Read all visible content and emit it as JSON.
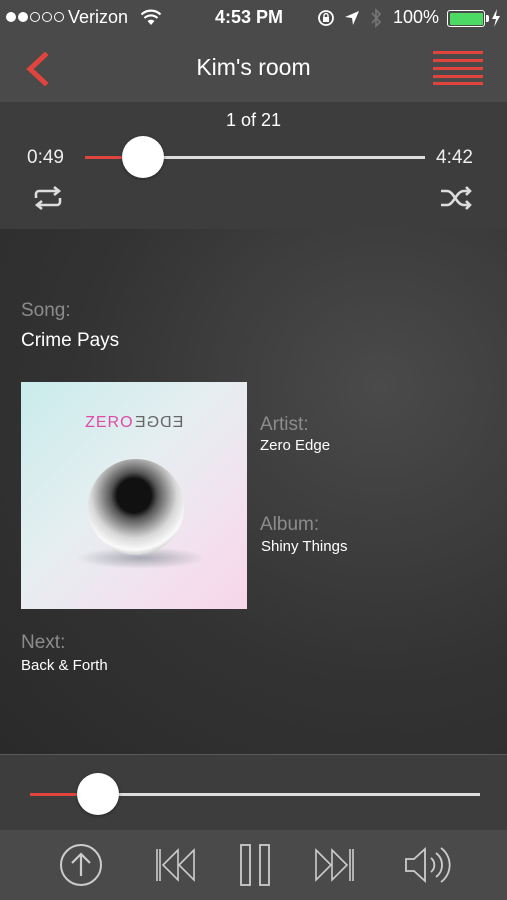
{
  "status": {
    "carrier": "Verizon",
    "time": "4:53 PM",
    "battery": "100%"
  },
  "nav": {
    "title": "Kim's room",
    "back_icon": "chevron-left-icon",
    "menu_icon": "menu-icon"
  },
  "playback": {
    "position": "1 of 21",
    "elapsed": "0:49",
    "total": "4:42",
    "progress": 0.17
  },
  "song": {
    "label": "Song:",
    "title": "Crime Pays"
  },
  "artist": {
    "label": "Artist:",
    "name": "Zero Edge"
  },
  "album": {
    "label": "Album:",
    "name": "Shiny Things",
    "art_text_left": "ZERO",
    "art_text_right": "EDGE"
  },
  "next": {
    "label": "Next:",
    "title": "Back & Forth"
  },
  "volume": {
    "level": 0.15
  },
  "colors": {
    "accent": "#e0443c",
    "panel": "#4a4a4a"
  }
}
